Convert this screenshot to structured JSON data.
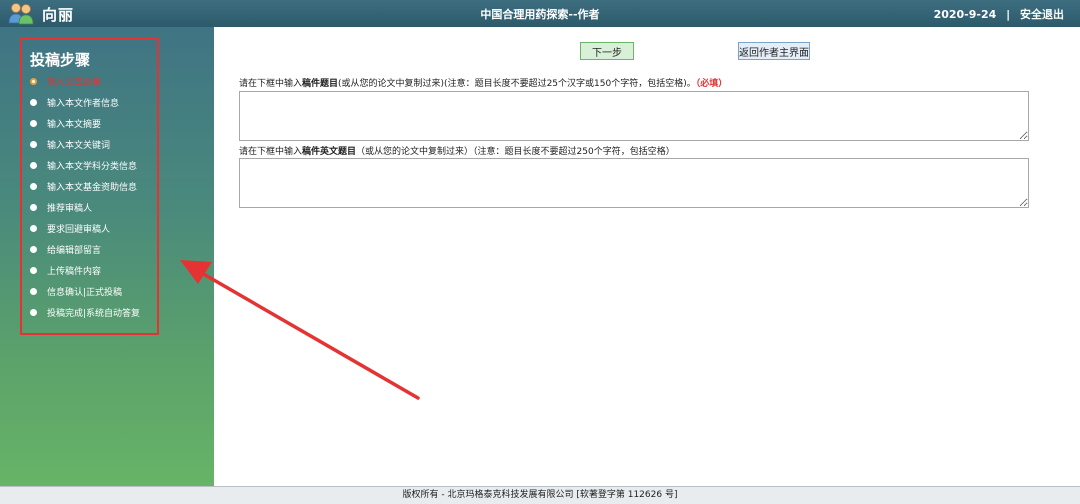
{
  "header": {
    "user_name": "向丽",
    "app_title": "中国合理用药探索--作者",
    "date": "2020-9-24",
    "separator": "|",
    "logout_label": "安全退出",
    "user_icon": "users-icon"
  },
  "sidebar": {
    "title": "投稿步骤",
    "active_index": 0,
    "steps": [
      {
        "label": "输入文章题目"
      },
      {
        "label": "输入本文作者信息"
      },
      {
        "label": "输入本文摘要"
      },
      {
        "label": "输入本文关键词"
      },
      {
        "label": "输入本文学科分类信息"
      },
      {
        "label": "输入本文基金资助信息"
      },
      {
        "label": "推荐审稿人"
      },
      {
        "label": "要求回避审稿人"
      },
      {
        "label": "给编辑部留言"
      },
      {
        "label": "上传稿件内容"
      },
      {
        "label": "信息确认|正式投稿"
      },
      {
        "label": "投稿完成|系统自动答复"
      }
    ]
  },
  "toolbar": {
    "next_label": "下一步",
    "home_label": "返回作者主界面"
  },
  "form": {
    "title_instr_prefix": "请在下框中输入",
    "title_instr_bold": "稿件题目",
    "title_instr_suffix": "(或从您的论文中复制过来)(注意：题目长度不要超过25个汉字或150个字符，包括空格)。",
    "title_required": "（必填）",
    "title_value": "",
    "en_instr_prefix": "请在下框中输入",
    "en_instr_bold": "稿件英文题目",
    "en_instr_suffix": "（或从您的论文中复制过来）（注意：题目长度不要超过250个字符，包括空格）",
    "en_value": ""
  },
  "footer": {
    "text": "版权所有 - 北京玛格泰克科技发展有限公司 [软著登字第 112626 号]"
  },
  "colors": {
    "highlight_red": "#e53333",
    "header_bg": "#2c5a6b",
    "sidebar_top": "#3f7484",
    "sidebar_bottom": "#67b467"
  }
}
